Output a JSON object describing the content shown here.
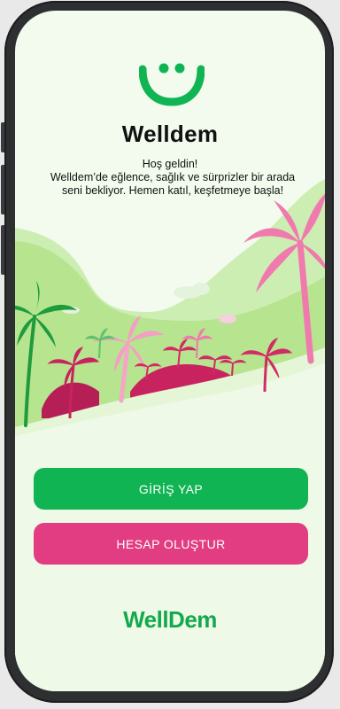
{
  "app": {
    "title": "Welldem",
    "greeting": "Hoş geldin!",
    "description": "Welldem’de eğlence, sağlık ve sürprizler bir arada seni bekliyor. Hemen katıl, keşfetmeye başla!",
    "brand_wordmark": "WellDem"
  },
  "actions": {
    "login_label": "GİRİŞ YAP",
    "signup_label": "HESAP OLUŞTUR"
  },
  "colors": {
    "primary_green": "#10b452",
    "primary_pink": "#e23d82",
    "background": "#f2fbee"
  },
  "icons": {
    "logo": "smiley-face-icon"
  }
}
